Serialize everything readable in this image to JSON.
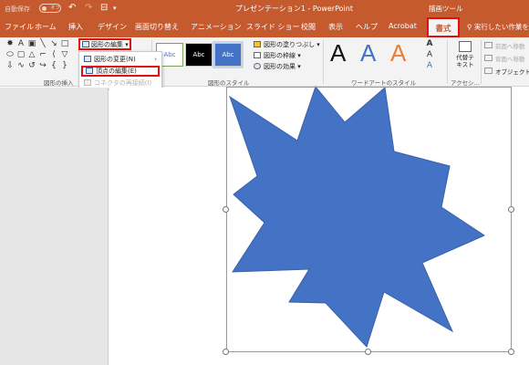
{
  "titlebar": {
    "autosave_label": "自動保存",
    "autosave_state": "オフ",
    "doc_title": "プレゼンテーション1 - PowerPoint",
    "context_tools": "描画ツール"
  },
  "tabs": {
    "items": [
      "ファイル",
      "ホーム",
      "挿入",
      "デザイン",
      "画面切り替え",
      "アニメーション",
      "スライド ショー",
      "校閲",
      "表示",
      "ヘルプ",
      "Acrobat"
    ],
    "format": "書式",
    "tell_me": "実行したい作業を"
  },
  "ribbon": {
    "edit_shape": "図形の編集",
    "insert_shapes_label": "図形の挿入",
    "shape_styles_label": "図形のスタイル",
    "thumb_text": "Abc",
    "fill": "図形の塗りつぶし",
    "outline": "図形の枠線",
    "effects": "図形の効果",
    "wordart_label": "ワードアートのスタイル",
    "wordart_letter": "A",
    "alt_text": "代替テキスト",
    "accessibility_label": "アクセシ...",
    "bring_forward": "前面へ移動",
    "send_backward": "背面へ移動",
    "selection_pane": "オブジェクトの選択"
  },
  "dropdown": {
    "change_shape": "図形の変更(N)",
    "edit_points": "頂点の編集(E)",
    "reroute": "コネクタの再接続(I)"
  },
  "colors": {
    "accent": "#c55a2e",
    "star_fill": "#4472c4",
    "highlight": "#dd1111"
  },
  "icons": [
    "undo-icon",
    "redo-icon",
    "present-icon",
    "edit-shape-icon",
    "change-shape-icon",
    "edit-points-icon",
    "reroute-connector-icon",
    "alt-text-icon",
    "search-icon"
  ]
}
